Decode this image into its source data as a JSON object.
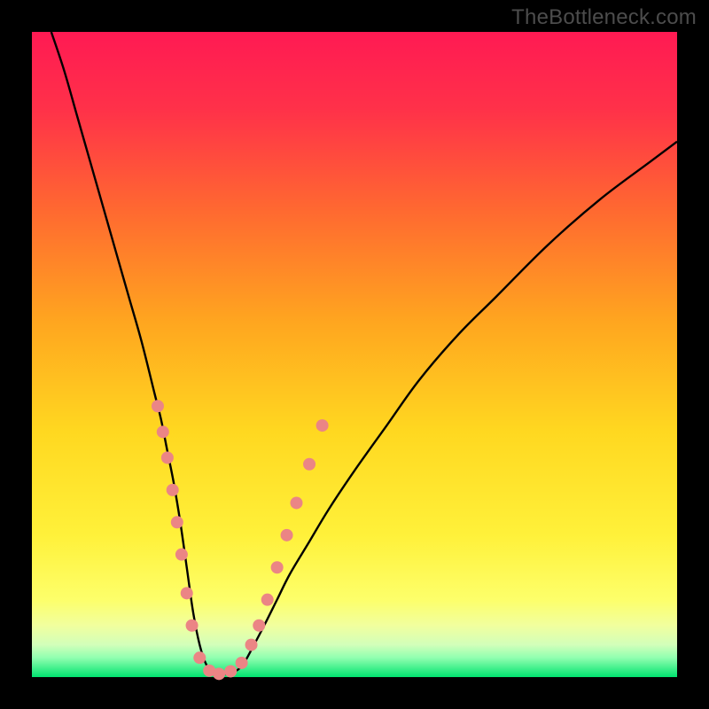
{
  "watermark": {
    "text": "TheBottleneck.com"
  },
  "colors": {
    "frame_bg": "#000000",
    "gradient_stops": [
      {
        "pct": 0,
        "color": "#ff1a53"
      },
      {
        "pct": 12,
        "color": "#ff3149"
      },
      {
        "pct": 28,
        "color": "#ff6a30"
      },
      {
        "pct": 45,
        "color": "#ffa61f"
      },
      {
        "pct": 62,
        "color": "#ffd820"
      },
      {
        "pct": 78,
        "color": "#fff13a"
      },
      {
        "pct": 88,
        "color": "#fdff6a"
      },
      {
        "pct": 92,
        "color": "#f1ff9e"
      },
      {
        "pct": 95,
        "color": "#d2ffba"
      },
      {
        "pct": 97,
        "color": "#91ffb0"
      },
      {
        "pct": 100,
        "color": "#00e36f"
      }
    ],
    "curve_stroke": "#000000",
    "marker_fill": "#eb8585",
    "marker_stroke": "#c05858"
  },
  "chart_data": {
    "type": "line",
    "title": "",
    "xlabel": "",
    "ylabel": "",
    "xlim": [
      0,
      100
    ],
    "ylim": [
      0,
      100
    ],
    "grid": false,
    "legend": false,
    "series": [
      {
        "name": "bottleneck-curve",
        "x": [
          3,
          5,
          7,
          9,
          11,
          13,
          15,
          17,
          19,
          20,
          21,
          22,
          23,
          24,
          25,
          26,
          27,
          28,
          29,
          30,
          31,
          32,
          33,
          34,
          36,
          38,
          40,
          43,
          46,
          50,
          55,
          60,
          66,
          72,
          80,
          88,
          96,
          100
        ],
        "y": [
          100,
          94,
          87,
          80,
          73,
          66,
          59,
          52,
          44,
          40,
          35,
          30,
          24,
          17,
          10,
          5,
          2,
          1,
          0.5,
          0.5,
          0.7,
          1.2,
          2.4,
          4.2,
          8,
          12,
          16,
          21,
          26,
          32,
          39,
          46,
          53,
          59,
          67,
          74,
          80,
          83
        ]
      }
    ],
    "markers": {
      "name": "highlighted-points",
      "points": [
        {
          "x": 19.5,
          "y": 42
        },
        {
          "x": 20.3,
          "y": 38
        },
        {
          "x": 21.0,
          "y": 34
        },
        {
          "x": 21.8,
          "y": 29
        },
        {
          "x": 22.5,
          "y": 24
        },
        {
          "x": 23.2,
          "y": 19
        },
        {
          "x": 24.0,
          "y": 13
        },
        {
          "x": 24.8,
          "y": 8
        },
        {
          "x": 26.0,
          "y": 3
        },
        {
          "x": 27.5,
          "y": 1
        },
        {
          "x": 29.0,
          "y": 0.5
        },
        {
          "x": 30.8,
          "y": 0.9
        },
        {
          "x": 32.5,
          "y": 2.2
        },
        {
          "x": 34.0,
          "y": 5
        },
        {
          "x": 35.2,
          "y": 8
        },
        {
          "x": 36.5,
          "y": 12
        },
        {
          "x": 38.0,
          "y": 17
        },
        {
          "x": 39.5,
          "y": 22
        },
        {
          "x": 41.0,
          "y": 27
        },
        {
          "x": 43.0,
          "y": 33
        },
        {
          "x": 45.0,
          "y": 39
        }
      ],
      "radius_px": 7
    }
  }
}
